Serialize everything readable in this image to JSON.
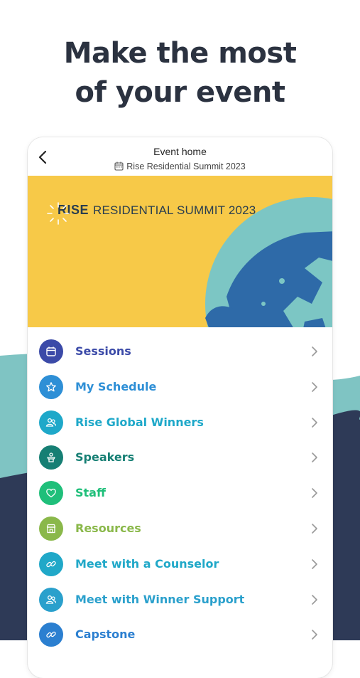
{
  "headline": {
    "line1": "Make the most",
    "line2": "of your event"
  },
  "topbar": {
    "back_icon": "chevron-left-icon",
    "title": "Event home",
    "subtitle": "Rise Residential Summit 2023",
    "subtitle_icon": "calendar-icon"
  },
  "banner": {
    "brand_strong": "RISE",
    "brand_rest": "RESIDENTIAL SUMMIT 2023",
    "background_color": "#f7c948"
  },
  "menu": {
    "items": [
      {
        "label": "Sessions",
        "icon": "calendar-icon",
        "color": "#3b4aa8"
      },
      {
        "label": "My Schedule",
        "icon": "star-icon",
        "color": "#2e8fd6"
      },
      {
        "label": "Rise Global Winners",
        "icon": "people-icon",
        "color": "#1ea8c9"
      },
      {
        "label": "Speakers",
        "icon": "speaker-podium-icon",
        "color": "#167f74"
      },
      {
        "label": "Staff",
        "icon": "heart-icon",
        "color": "#1fbf7a"
      },
      {
        "label": "Resources",
        "icon": "store-icon",
        "color": "#8ab84a"
      },
      {
        "label": "Meet with a Counselor",
        "icon": "link-icon",
        "color": "#20a8c8"
      },
      {
        "label": "Meet with Winner Support",
        "icon": "people-icon",
        "color": "#2aa0cc"
      },
      {
        "label": "Capstone",
        "icon": "link-icon",
        "color": "#2b7fd0"
      }
    ]
  },
  "colors": {
    "headline_text": "#2b3240",
    "wave_teal": "#7fc4c3",
    "wave_navy": "#2e3a57"
  }
}
